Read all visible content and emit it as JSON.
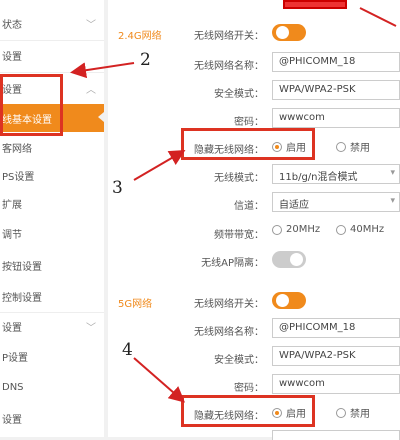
{
  "sidebar": {
    "items": [
      {
        "label": "状态",
        "chevron": "﹀"
      },
      {
        "label": "设置"
      },
      {
        "label": "设置",
        "chevron": "︿"
      },
      {
        "label": "线基本设置"
      },
      {
        "label": "客网络"
      },
      {
        "label": "PS设置"
      },
      {
        "label": "扩展"
      },
      {
        "label": "调节"
      },
      {
        "label": "按钮设置"
      },
      {
        "label": "控制设置"
      },
      {
        "label": "设置",
        "chevron": "﹀"
      },
      {
        "label": "P设置"
      },
      {
        "label": "DNS"
      },
      {
        "label": "设置"
      }
    ]
  },
  "band24": {
    "section": "2.4G网络",
    "switch_label": "无线网络开关：",
    "ssid_label": "无线网络名称：",
    "ssid_value": "@PHICOMM_18",
    "security_label": "安全模式：",
    "security_value": "WPA/WPA2-PSK",
    "password_label": "密码：",
    "password_value": "wwwcom",
    "hide_label": "隐藏无线网络：",
    "enable": "启用",
    "disable": "禁用",
    "mode_label": "无线模式：",
    "mode_value": "11b/g/n混合模式",
    "channel_label": "信道：",
    "channel_value": "自适应",
    "bandwidth_label": "频带带宽：",
    "bw_20": "20MHz",
    "bw_40": "40MHz",
    "isolation_label": "无线AP隔离："
  },
  "band5": {
    "section": "5G网络",
    "switch_label": "无线网络开关：",
    "ssid_label": "无线网络名称：",
    "ssid_value": "@PHICOMM_18",
    "security_label": "安全模式：",
    "security_value": "WPA/WPA2-PSK",
    "password_label": "密码：",
    "password_value": "wwwcom",
    "hide_label": "隐藏无线网络：",
    "enable": "启用",
    "disable": "禁用"
  },
  "annotations": {
    "n2": "2",
    "n3": "3",
    "n4": "4"
  },
  "colors": {
    "accent": "#f08a1c",
    "annotation": "#d32222"
  },
  "icons": {
    "dropdown": "▾"
  }
}
